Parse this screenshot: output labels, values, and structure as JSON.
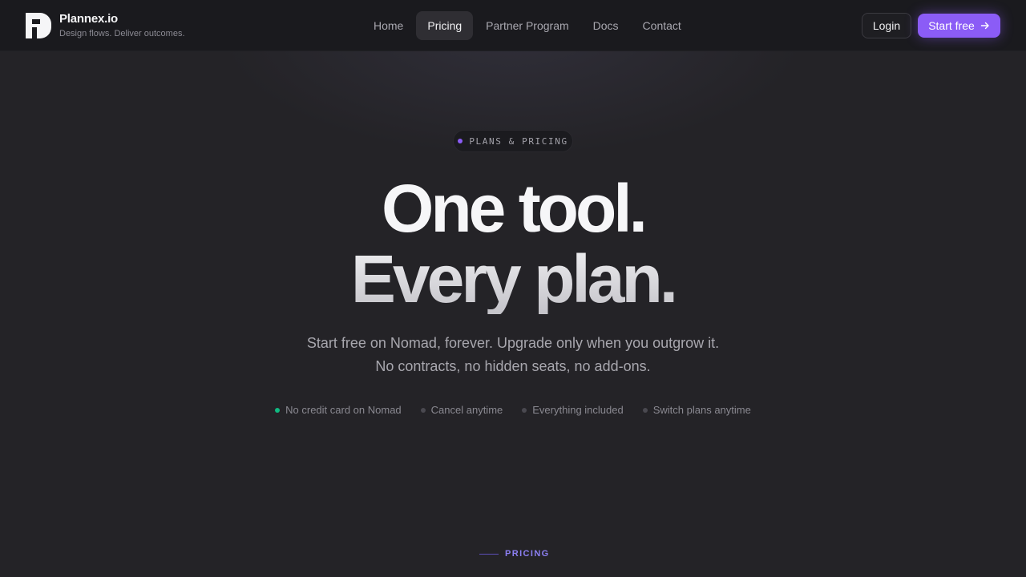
{
  "header": {
    "brand_name": "Plannex.io",
    "brand_tagline": "Design flows. Deliver outcomes.",
    "nav": [
      {
        "label": "Home",
        "active": false
      },
      {
        "label": "Pricing",
        "active": true
      },
      {
        "label": "Partner Program",
        "active": false
      },
      {
        "label": "Docs",
        "active": false
      },
      {
        "label": "Contact",
        "active": false
      }
    ],
    "login_label": "Login",
    "start_label": "Start free",
    "start_icon": "arrow-right-icon"
  },
  "hero": {
    "eyebrow": "PLANS & PRICING",
    "headline_line1": "One tool.",
    "headline_line2": "Every plan.",
    "subtitle_line1": "Start free on Nomad, forever. Upgrade only when you outgrow it.",
    "subtitle_line2": "No contracts, no hidden seats, no add-ons.",
    "features": [
      {
        "label": "No credit card on Nomad",
        "dot": "green"
      },
      {
        "label": "Cancel anytime",
        "dot": "gray"
      },
      {
        "label": "Everything included",
        "dot": "gray"
      },
      {
        "label": "Switch plans anytime",
        "dot": "gray"
      }
    ]
  },
  "section": {
    "label": "PRICING"
  },
  "colors": {
    "accent": "#8b5cf6",
    "success": "#10b981",
    "background": "#242327",
    "header_bg": "#1a1a1e"
  }
}
